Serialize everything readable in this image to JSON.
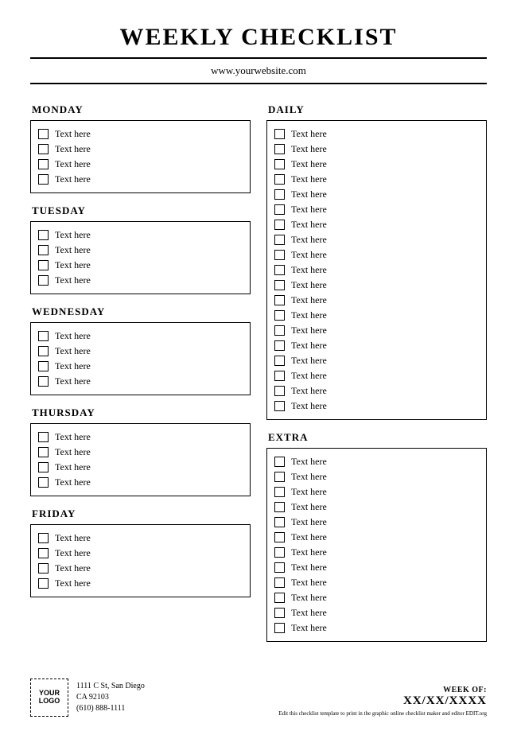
{
  "header": {
    "title": "WEEKLY CHECKLIST",
    "website": "www.yourwebsite.com"
  },
  "left_sections": [
    {
      "title": "MONDAY",
      "items": [
        "Text here",
        "Text here",
        "Text here",
        "Text here"
      ]
    },
    {
      "title": "TUESDAY",
      "items": [
        "Text here",
        "Text here",
        "Text here",
        "Text here"
      ]
    },
    {
      "title": "WEDNESDAY",
      "items": [
        "Text here",
        "Text here",
        "Text here",
        "Text here"
      ]
    },
    {
      "title": "THURSDAY",
      "items": [
        "Text here",
        "Text here",
        "Text here",
        "Text here"
      ]
    },
    {
      "title": "FRIDAY",
      "items": [
        "Text here",
        "Text here",
        "Text here",
        "Text here"
      ]
    }
  ],
  "right_sections": [
    {
      "title": "DAILY",
      "items": [
        "Text here",
        "Text here",
        "Text here",
        "Text here",
        "Text here",
        "Text here",
        "Text here",
        "Text here",
        "Text here",
        "Text here",
        "Text here",
        "Text here",
        "Text here",
        "Text here",
        "Text here",
        "Text here",
        "Text here",
        "Text here",
        "Text here"
      ]
    },
    {
      "title": "EXTRA",
      "items": [
        "Text here",
        "Text here",
        "Text here",
        "Text here",
        "Text here",
        "Text here",
        "Text here",
        "Text here",
        "Text here",
        "Text here",
        "Text here",
        "Text here"
      ]
    }
  ],
  "footer": {
    "logo": "YOUR\nLOGO",
    "address1": "1111 C St, San Diego",
    "address2": "CA 92103",
    "phone": "(610) 888-1111",
    "week_label": "WEEK OF:",
    "week_value": "XX/XX/XXXX",
    "edit_note": "Edit this checklist template to print in the graphic online checklist maker and editor EDIT.org"
  }
}
